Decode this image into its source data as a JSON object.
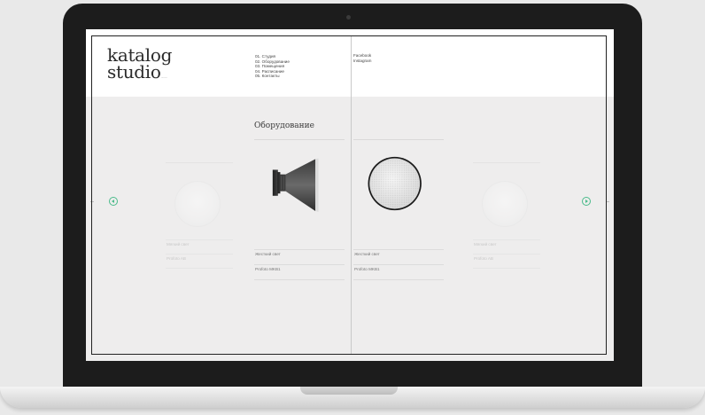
{
  "site": {
    "logo": {
      "line1": "katalog",
      "line2": "studio",
      "suffix": "........"
    },
    "menu": [
      "01. Студия",
      "02. Оборудование",
      "03. Помещения",
      "04. Расписание",
      "05. Контакты"
    ],
    "social": [
      "Facebook",
      "Instagram"
    ]
  },
  "section": {
    "title": "Оборудование"
  },
  "carousel": {
    "accent_color": "#4bbb8b",
    "items": [
      {
        "icon": "softbox-disc-icon",
        "caption1": "Мягкий свет",
        "caption2": "Profoto AB"
      },
      {
        "icon": "reflector-icon",
        "caption1": "Жесткий свет",
        "caption2": "Profoto MKB1"
      },
      {
        "icon": "honeycomb-grid-icon",
        "caption1": "Жесткий свет",
        "caption2": "Profoto MKB1"
      },
      {
        "icon": "softbox-disc-icon",
        "caption1": "Мягкий свет",
        "caption2": "Profoto AB"
      }
    ]
  }
}
